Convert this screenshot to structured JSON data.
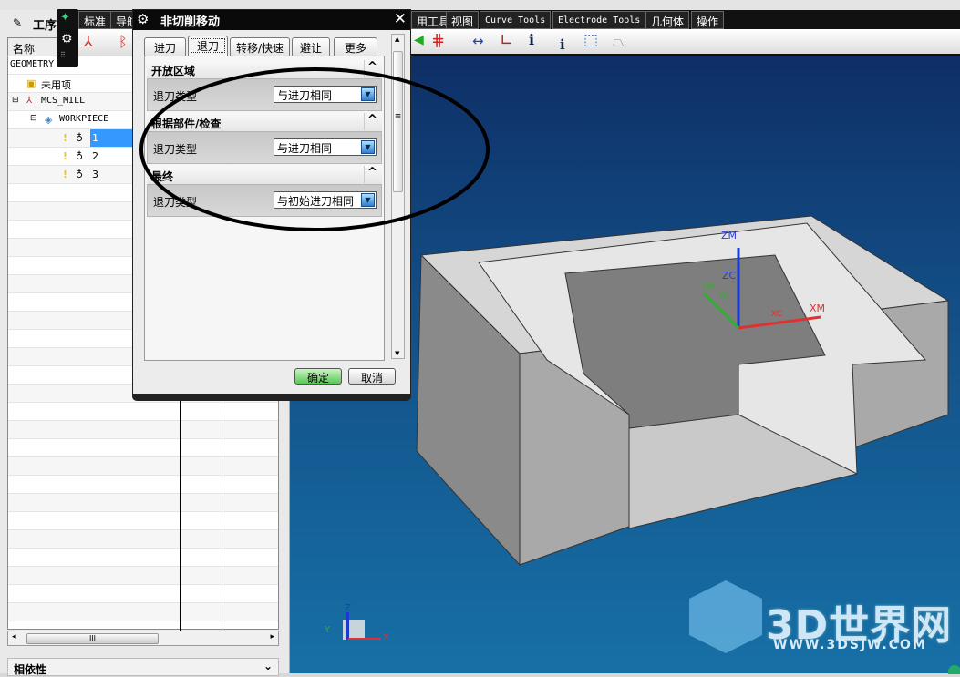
{
  "nav": {
    "title": "工序",
    "col_name": "名称",
    "view_label": "GEOMETRY",
    "items": [
      {
        "label": "未用项"
      },
      {
        "label": "MCS_MILL"
      },
      {
        "label": "WORKPIECE"
      },
      {
        "label": "1",
        "selected": true
      },
      {
        "label": "2"
      },
      {
        "label": "3"
      }
    ],
    "dependency_label": "相依性",
    "scroll_thumb": "III"
  },
  "ribbon": {
    "tabs": [
      "标准",
      "导航",
      "用工具",
      "视图",
      "Curve Tools",
      "Electrode Tools",
      "几何体",
      "操作"
    ]
  },
  "dialog": {
    "title": "非切削移动",
    "close": "✕",
    "tabs": [
      "进刀",
      "退刀",
      "转移/快速",
      "避让",
      "更多"
    ],
    "active_tab": "退刀",
    "sections": [
      {
        "title": "开放区域",
        "label": "退刀类型",
        "value": "与进刀相同"
      },
      {
        "title": "根据部件/检查",
        "label": "退刀类型",
        "value": "与进刀相同"
      },
      {
        "title": "最终",
        "label": "退刀类型",
        "value": "与初始进刀相同"
      }
    ],
    "ok": "确定",
    "cancel": "取消"
  },
  "viewport": {
    "axes": {
      "zm": "ZM",
      "zc": "ZC",
      "xm": "XM",
      "xc": "XC",
      "ym": "YM",
      "yc": "YC"
    },
    "triad": {
      "x": "X",
      "y": "Y",
      "z": "Z"
    }
  },
  "watermark": {
    "main": "3D世界网",
    "sub": "WWW.3DSJW.COM"
  },
  "colors": {
    "accent": "#3399ff",
    "viewport_top": "#0e2f66",
    "viewport_bottom": "#1670a6",
    "ok": "#5cc65a"
  }
}
